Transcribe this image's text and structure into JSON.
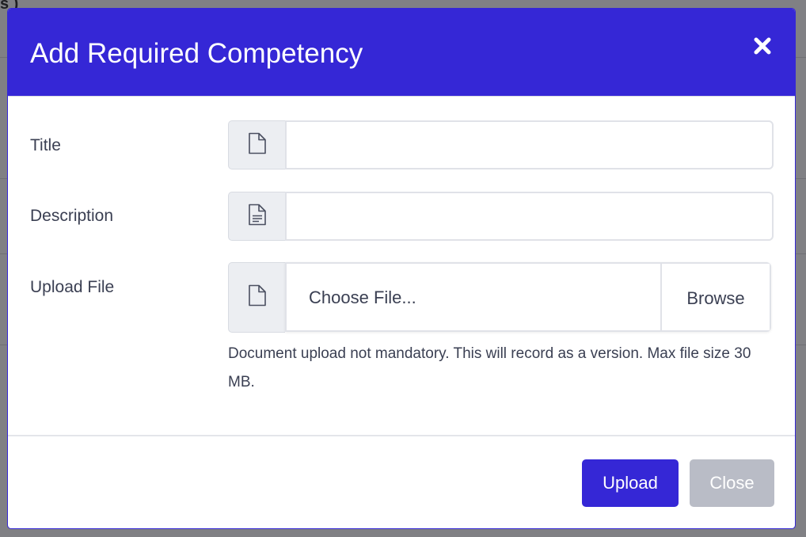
{
  "background": {
    "partial_text": "s  )"
  },
  "modal": {
    "title": "Add Required Competency",
    "close_icon": "close-x-icon",
    "fields": {
      "title_label": "Title",
      "title_value": "",
      "title_icon": "document-icon",
      "description_label": "Description",
      "description_value": "",
      "description_icon": "text-document-icon",
      "upload_label": "Upload File",
      "upload_icon": "document-icon",
      "choose_file_text": "Choose File...",
      "browse_label": "Browse",
      "help_text": "Document upload not mandatory. This will record as a version. Max file size 30 MB."
    },
    "footer": {
      "upload_label": "Upload",
      "close_label": "Close"
    }
  },
  "colors": {
    "primary": "#3527d6",
    "secondary": "#b9bcc6",
    "text": "#3a3f52",
    "addon_bg": "#eceef2"
  }
}
